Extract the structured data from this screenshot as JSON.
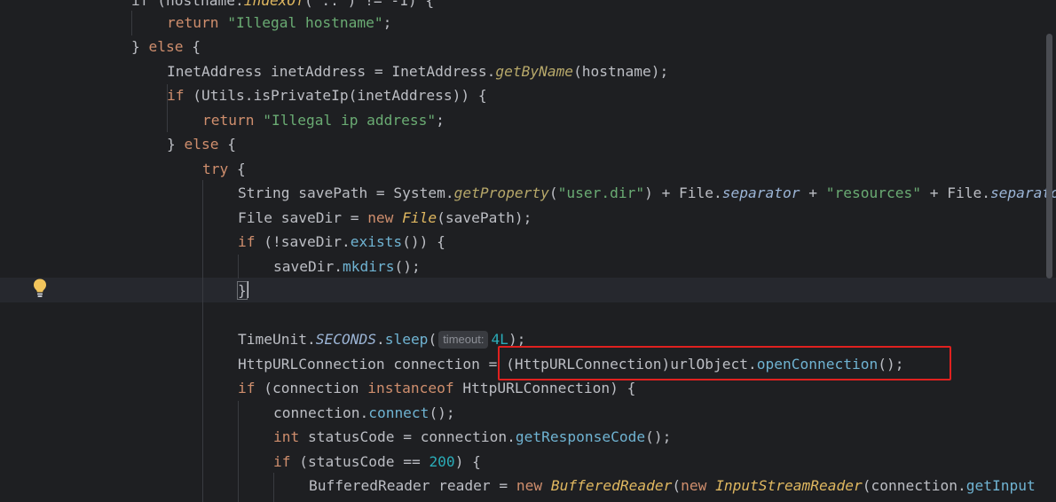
{
  "editor": {
    "language": "Java",
    "lines": [
      {
        "id": "l0",
        "segments": [
          [
            "",
            "if (hostname."
          ],
          [
            "mth",
            "indexOf"
          ],
          [
            "",
            "(\"..\") != -1) {"
          ]
        ]
      },
      {
        "id": "l1",
        "segments": [
          [
            "kw",
            "return "
          ],
          [
            "str",
            "\"Illegal hostname\""
          ],
          [
            "",
            ";"
          ]
        ]
      },
      {
        "id": "l2",
        "segments": [
          [
            "",
            "} "
          ],
          [
            "kw",
            "else"
          ],
          [
            "",
            " {"
          ]
        ]
      },
      {
        "id": "l3",
        "segments": [
          [
            "",
            "InetAddress inetAddress = InetAddress."
          ],
          [
            "sfn",
            "getByName"
          ],
          [
            "",
            "(hostname);"
          ]
        ]
      },
      {
        "id": "l4",
        "segments": [
          [
            "kw",
            "if"
          ],
          [
            "",
            " (Utils.isPrivateIp(inetAddress)) {"
          ]
        ]
      },
      {
        "id": "l5",
        "segments": [
          [
            "kw",
            "return "
          ],
          [
            "str",
            "\"Illegal ip address\""
          ],
          [
            "",
            ";"
          ]
        ]
      },
      {
        "id": "l6",
        "segments": [
          [
            "",
            "} "
          ],
          [
            "kw",
            "else"
          ],
          [
            "",
            " {"
          ]
        ]
      },
      {
        "id": "l7",
        "segments": [
          [
            "kw",
            "try"
          ],
          [
            "",
            " {"
          ]
        ]
      },
      {
        "id": "l8",
        "segments": [
          [
            "",
            "String savePath = System."
          ],
          [
            "sfn",
            "getProperty"
          ],
          [
            "",
            "("
          ],
          [
            "str",
            "\"user.dir\""
          ],
          [
            "",
            ") + File."
          ],
          [
            "sfield",
            "separator"
          ],
          [
            "",
            " + "
          ],
          [
            "str",
            "\"resources\""
          ],
          [
            "",
            " + File."
          ],
          [
            "sfield",
            "separator"
          ]
        ]
      },
      {
        "id": "l9",
        "segments": [
          [
            "",
            "File saveDir = "
          ],
          [
            "kw",
            "new "
          ],
          [
            "mth",
            "File"
          ],
          [
            "",
            "(savePath);"
          ]
        ]
      },
      {
        "id": "l10",
        "segments": [
          [
            "kw",
            "if"
          ],
          [
            "",
            " (!saveDir."
          ],
          [
            "m",
            "exists"
          ],
          [
            "",
            "()) {"
          ]
        ]
      },
      {
        "id": "l11",
        "segments": [
          [
            "",
            "saveDir."
          ],
          [
            "m",
            "mkdirs"
          ],
          [
            "",
            "();"
          ]
        ]
      },
      {
        "id": "l12",
        "segments": [
          [
            "",
            "}"
          ]
        ]
      },
      {
        "id": "l13",
        "segments": []
      },
      {
        "id": "l14",
        "segments": [
          [
            "",
            "TimeUnit."
          ],
          [
            "sfield",
            "SECONDS"
          ],
          [
            "",
            "."
          ],
          [
            "m",
            "sleep"
          ],
          [
            "",
            "("
          ],
          [
            "hint",
            "timeout:"
          ],
          [
            "num",
            "4L"
          ],
          [
            "",
            ");"
          ]
        ]
      },
      {
        "id": "l15",
        "segments": [
          [
            "",
            "HttpURLConnection connection = (HttpURLConnection)urlObject."
          ],
          [
            "m",
            "openConnection"
          ],
          [
            "",
            "();"
          ]
        ]
      },
      {
        "id": "l16",
        "segments": [
          [
            "kw",
            "if"
          ],
          [
            "",
            " (connection "
          ],
          [
            "kw",
            "instanceof"
          ],
          [
            "",
            " HttpURLConnection) {"
          ]
        ]
      },
      {
        "id": "l17",
        "segments": [
          [
            "",
            "connection."
          ],
          [
            "m",
            "connect"
          ],
          [
            "",
            "();"
          ]
        ]
      },
      {
        "id": "l18",
        "segments": [
          [
            "kw",
            "int"
          ],
          [
            "",
            " statusCode = connection."
          ],
          [
            "m",
            "getResponseCode"
          ],
          [
            "",
            "();"
          ]
        ]
      },
      {
        "id": "l19",
        "segments": [
          [
            "kw",
            "if"
          ],
          [
            "",
            " (statusCode == "
          ],
          [
            "num",
            "200"
          ],
          [
            "",
            ") {"
          ]
        ]
      },
      {
        "id": "l20",
        "segments": [
          [
            "",
            "BufferedReader reader = "
          ],
          [
            "kw",
            "new "
          ],
          [
            "mth",
            "BufferedReader"
          ],
          [
            "",
            "("
          ],
          [
            "kw",
            "new "
          ],
          [
            "mth",
            "InputStreamReader"
          ],
          [
            "",
            "(connection."
          ],
          [
            "m",
            "getInput"
          ]
        ]
      }
    ]
  },
  "colors": {
    "background": "#1e1f22",
    "keyword": "#cf8e6d",
    "string": "#6aab73",
    "number": "#2aacb8",
    "highlight_box": "#e0211f"
  },
  "icons": {
    "intention_bulb": "lightbulb-icon"
  }
}
